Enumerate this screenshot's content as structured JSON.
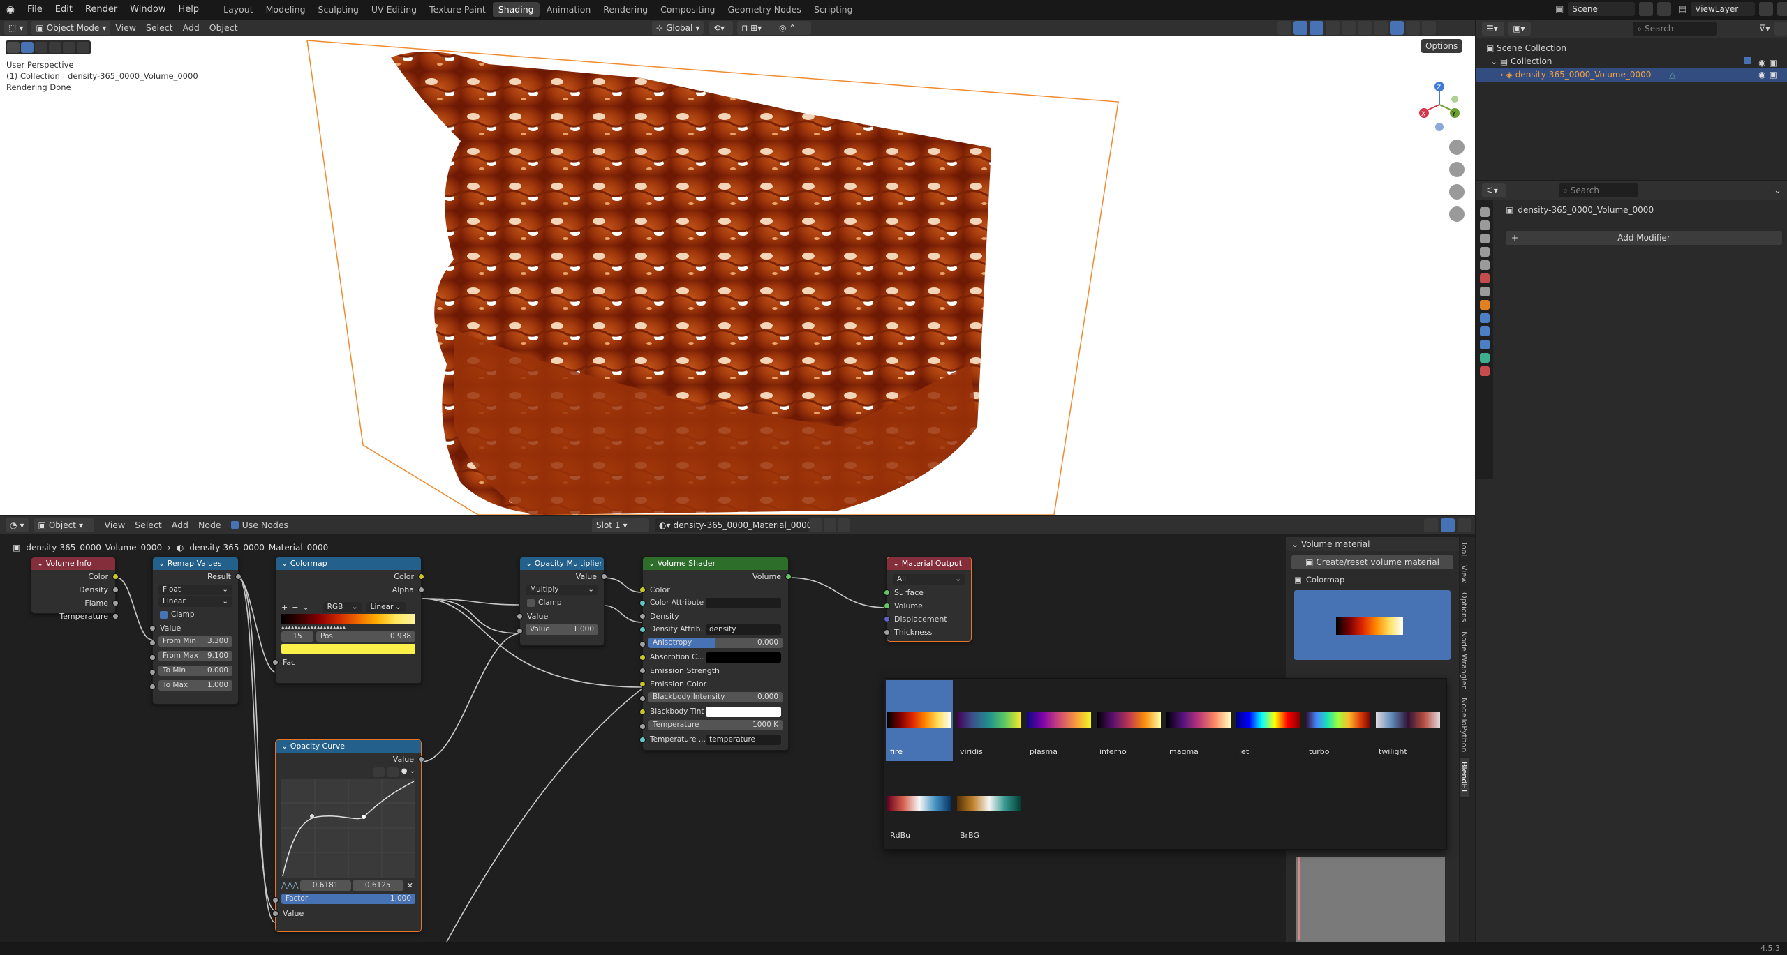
{
  "menubar": {
    "items": [
      "File",
      "Edit",
      "Render",
      "Window",
      "Help"
    ],
    "workspaces": [
      "Layout",
      "Modeling",
      "Sculpting",
      "UV Editing",
      "Texture Paint",
      "Shading",
      "Animation",
      "Rendering",
      "Compositing",
      "Geometry Nodes",
      "Scripting"
    ],
    "active_workspace": "Shading",
    "scene": "Scene",
    "view_layer": "ViewLayer"
  },
  "viewport": {
    "mode": "Object Mode",
    "menus": [
      "View",
      "Select",
      "Add",
      "Object"
    ],
    "transform": "Global",
    "options": "Options",
    "overlay": [
      "User Perspective",
      "(1) Collection | density-365_0000_Volume_0000",
      "Rendering Done"
    ],
    "gizmo": {
      "x": "X",
      "y": "Y",
      "z": "Z"
    }
  },
  "node_editor": {
    "header": {
      "type": "Object",
      "menus": [
        "View",
        "Select",
        "Add",
        "Node"
      ],
      "use_nodes": "Use Nodes",
      "slot": "Slot 1",
      "material": "density-365_0000_Material_0000"
    },
    "breadcrumb": {
      "object": "density-365_0000_Volume_0000",
      "material": "density-365_0000_Material_0000"
    },
    "nodes": {
      "volume_info": {
        "title": "Volume Info",
        "outputs": [
          "Color",
          "Density",
          "Flame",
          "Temperature"
        ]
      },
      "remap": {
        "title": "Remap Values",
        "result": "Result",
        "type": "Float",
        "interp": "Linear",
        "clamp": "Clamp",
        "value": "Value",
        "fields": [
          {
            "label": "From Min",
            "value": "3.300"
          },
          {
            "label": "From Max",
            "value": "9.100"
          },
          {
            "label": "To Min",
            "value": "0.000"
          },
          {
            "label": "To Max",
            "value": "1.000"
          }
        ]
      },
      "colormap": {
        "title": "Colormap",
        "color": "Color",
        "alpha": "Alpha",
        "mode": "RGB",
        "interp": "Linear",
        "stop_index": "15",
        "pos_label": "Pos",
        "pos_value": "0.938",
        "fac": "Fac"
      },
      "opacity_mult": {
        "title": "Opacity Multiplier",
        "value_out": "Value",
        "op": "Multiply",
        "clamp": "Clamp",
        "value_in": "Value",
        "field_label": "Value",
        "field_value": "1.000"
      },
      "volume_shader": {
        "title": "Volume Shader",
        "out": "Volume",
        "rows": [
          "Color",
          "Color Attribute",
          "Density",
          "Density Attrib...",
          "Anisotropy",
          "Absorption C...",
          "Emission Strength",
          "Emission Color",
          "Blackbody Intensity",
          "Blackbody Tint",
          "Temperature",
          "Temperature ..."
        ],
        "density_attr": "density",
        "anisotropy": "0.000",
        "bb_intensity": "0.000",
        "temperature": "1000 K",
        "temp_attr": "temperature"
      },
      "material_output": {
        "title": "Material Output",
        "target": "All",
        "inputs": [
          "Surface",
          "Volume",
          "Displacement",
          "Thickness"
        ]
      },
      "opacity_curve": {
        "title": "Opacity Curve",
        "value_out": "Value",
        "pt_x": "0.6181",
        "pt_y": "0.6125",
        "factor_label": "Factor",
        "factor_value": "1.000",
        "value_in": "Value"
      }
    },
    "sidebar": {
      "panel": "Volume material",
      "button": "Create/reset volume material",
      "colormap_label": "Colormap",
      "tabs": [
        "Tool",
        "View",
        "Options",
        "Node Wrangler",
        "NodeToPython",
        "BlendET"
      ]
    },
    "colormap_picker": [
      {
        "name": "fire"
      },
      {
        "name": "viridis"
      },
      {
        "name": "plasma"
      },
      {
        "name": "inferno"
      },
      {
        "name": "magma"
      },
      {
        "name": "jet"
      },
      {
        "name": "turbo"
      },
      {
        "name": "twilight"
      },
      {
        "name": "RdBu"
      },
      {
        "name": "BrBG"
      }
    ],
    "selected_colormap": "fire"
  },
  "outliner": {
    "search_placeholder": "Search",
    "scene_collection": "Scene Collection",
    "collection": "Collection",
    "object": "density-365_0000_Volume_0000"
  },
  "properties": {
    "search_placeholder": "Search",
    "object": "density-365_0000_Volume_0000",
    "add_modifier": "Add Modifier"
  },
  "status": {
    "version": "4.5.3"
  },
  "colors": {
    "accent": "#4772b3",
    "selection": "#e8752a"
  }
}
